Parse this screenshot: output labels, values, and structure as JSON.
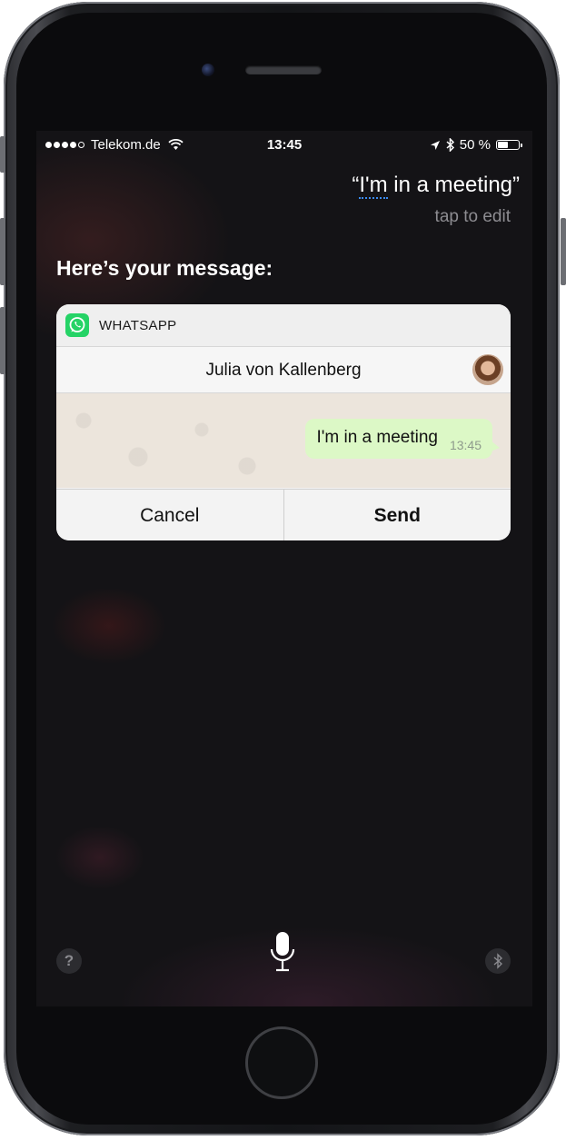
{
  "status_bar": {
    "carrier": "Telekom.de",
    "time": "13:45",
    "battery": "50 %",
    "battery_level": 0.5,
    "signal_bars": 4,
    "signal_max": 5
  },
  "siri": {
    "quote_open": "“",
    "quote_underlined": "I'm",
    "quote_rest": " in a meeting”",
    "tap_to_edit": "tap to edit",
    "heading": "Here’s your message:"
  },
  "card": {
    "app_name": "WHATSAPP",
    "contact_name": "Julia von Kallenberg",
    "message_text": "I'm in a meeting",
    "message_time": "13:45",
    "cancel_label": "Cancel",
    "send_label": "Send"
  },
  "bottom": {
    "help_label": "?"
  },
  "colors": {
    "whatsapp_green": "#25d366",
    "bubble_green": "#dcf8c6",
    "siri_underline": "#3a8cf0"
  },
  "icons": [
    "wifi-icon",
    "location-arrow-icon",
    "bluetooth-icon",
    "battery-icon",
    "whatsapp-icon",
    "microphone-icon",
    "help-icon"
  ]
}
